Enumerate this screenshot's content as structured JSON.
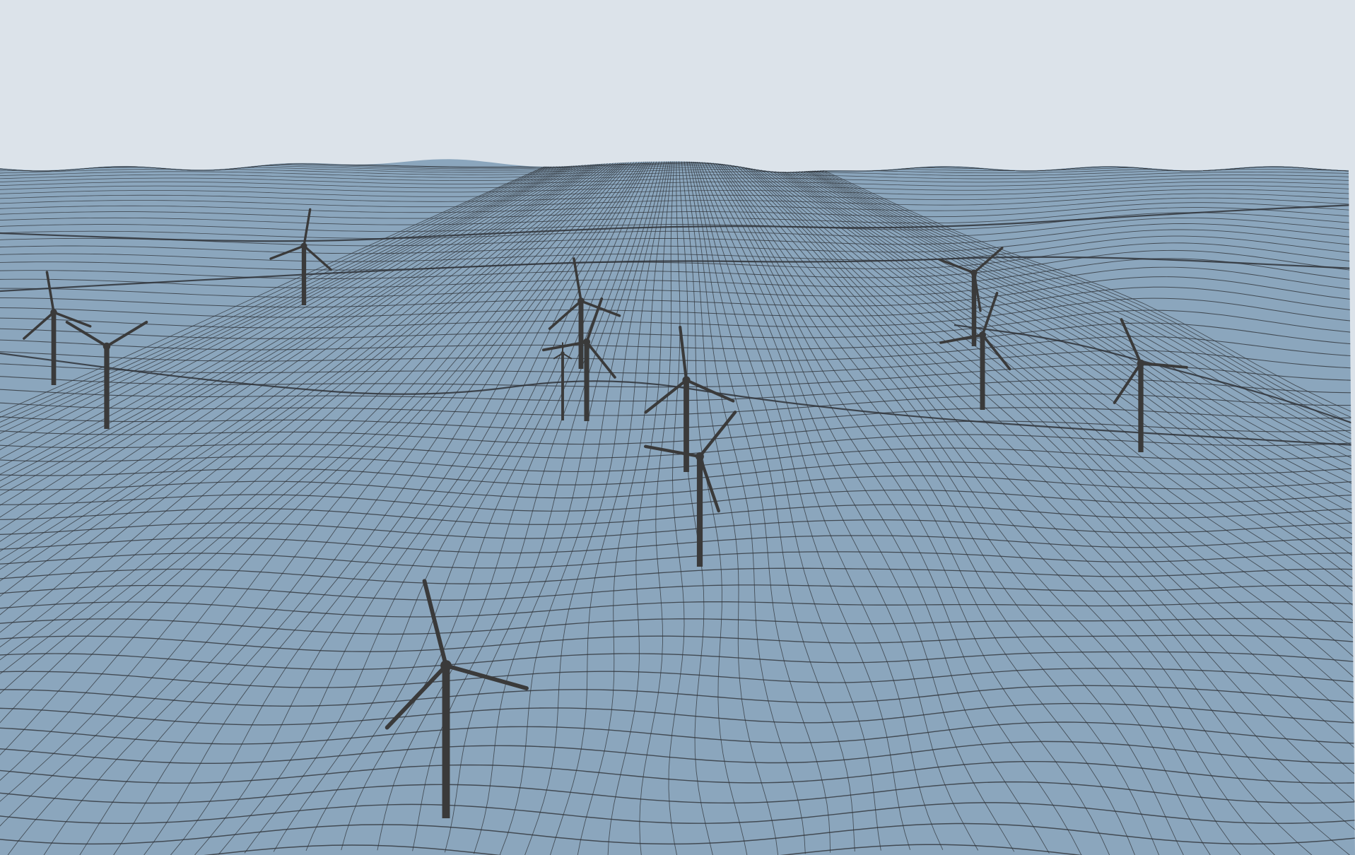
{
  "scene": {
    "type": "terrain-wireframe-3d-view",
    "colors": {
      "sky": "#dce3ea",
      "terrain": "#8ba6bd",
      "mesh_lines": "#2f3338",
      "turbine": "#3a3a3a"
    },
    "objects": {
      "turbine_count": 12
    }
  }
}
